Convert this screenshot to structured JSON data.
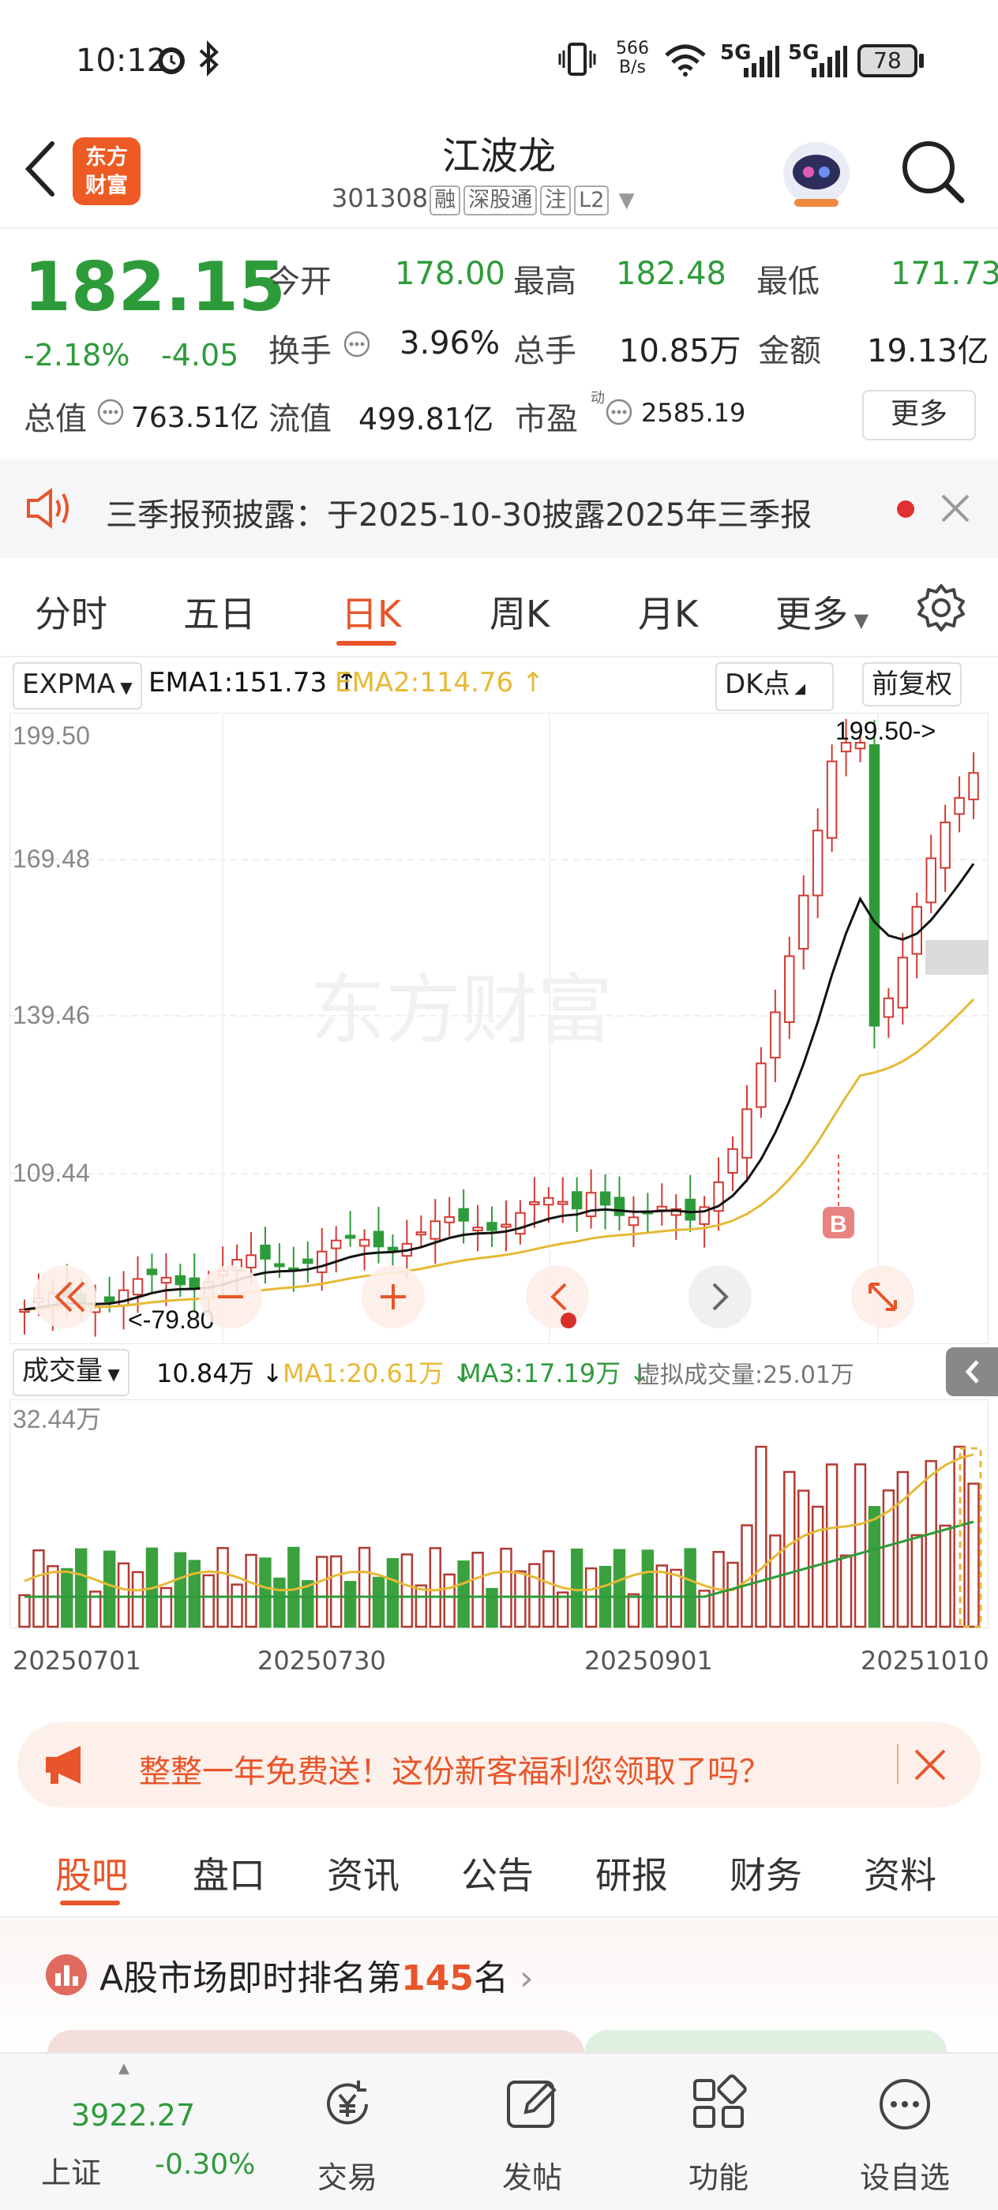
{
  "status_bar": {
    "time": "10:12",
    "net_speed_top": "566",
    "net_speed_bottom": "B/s",
    "sig1": "5G",
    "sig2": "5G",
    "battery": "78"
  },
  "header": {
    "logo_line1": "东方",
    "logo_line2": "财富",
    "stock_name": "江波龙",
    "stock_code": "301308",
    "tags": [
      "融",
      "深股通",
      "注",
      "L2"
    ]
  },
  "quote": {
    "price": "182.15",
    "change_pct": "-2.18%",
    "change": "-4.05",
    "open_label": "今开",
    "open": "178.00",
    "high_label": "最高",
    "high": "182.48",
    "low_label": "最低",
    "low": "171.73",
    "turnover_label": "换手",
    "turnover": "3.96%",
    "volume_label": "总手",
    "volume": "10.85万",
    "amount_label": "金额",
    "amount": "19.13亿",
    "mktcap_label": "总值",
    "mktcap": "763.51亿",
    "float_label": "流值",
    "float": "499.81亿",
    "pe_label": "市盈",
    "pe_sup": "动",
    "pe": "2585.19",
    "more_label": "更多"
  },
  "notice": {
    "text": "三季报预披露：于2025-10-30披露2025年三季报"
  },
  "tabs": [
    "分时",
    "五日",
    "日K",
    "周K",
    "月K",
    "更多",
    "settings"
  ],
  "tab_active": 2,
  "indicators": {
    "selector": "EXPMA",
    "ema1": "EMA1:151.73",
    "ema2": "EMA2:114.76",
    "dk_label": "DK点",
    "adjust_label": "前复权"
  },
  "kline": {
    "y_labels": [
      "199.50",
      "169.48",
      "139.46",
      "109.44"
    ],
    "max_marker": "199.50->",
    "min_marker": "<-79.80",
    "buy_marker": "B",
    "watermark": "东方财富"
  },
  "volume": {
    "selector": "成交量",
    "vol": "10.84万",
    "ma1": "MA1:20.61万",
    "ma3": "MA3:17.19万",
    "virtual": "虚拟成交量:25.01万",
    "y_max": "32.44万"
  },
  "dates": [
    "20250701",
    "20250730",
    "20250901",
    "20251010"
  ],
  "promo": {
    "text": "整整一年免费送！这份新客福利您领取了吗？"
  },
  "subtabs": [
    "股吧",
    "盘口",
    "资讯",
    "公告",
    "研报",
    "财务",
    "资料"
  ],
  "subtab_active": 0,
  "rank": {
    "prefix": "A股市场即时排名第",
    "num": "145",
    "suffix": "名"
  },
  "bottom_nav": {
    "index_value": "3922.27",
    "index_name": "上证",
    "index_change": "-0.30%",
    "items": [
      "交易",
      "发帖",
      "功能",
      "设自选"
    ]
  },
  "colors": {
    "up": "#d23a32",
    "down": "#2e9b3a",
    "accent": "#e8552a",
    "ema1": "#111111",
    "ema2": "#e6b935"
  }
}
